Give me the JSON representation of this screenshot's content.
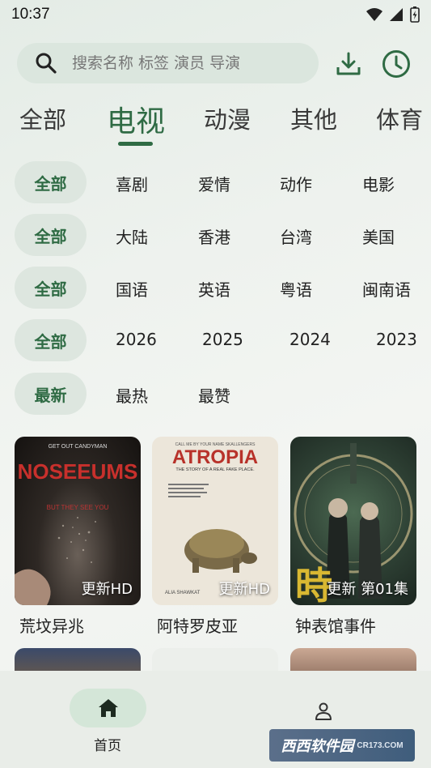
{
  "status": {
    "time": "10:37"
  },
  "search": {
    "placeholder": "搜索名称 标签 演员 导演"
  },
  "categories": [
    {
      "label": "全部"
    },
    {
      "label": "电视"
    },
    {
      "label": "动漫"
    },
    {
      "label": "其他"
    },
    {
      "label": "体育"
    }
  ],
  "filters": [
    {
      "chip": "全部",
      "options": [
        "喜剧",
        "爱情",
        "动作",
        "电影"
      ]
    },
    {
      "chip": "全部",
      "options": [
        "大陆",
        "香港",
        "台湾",
        "美国"
      ]
    },
    {
      "chip": "全部",
      "options": [
        "国语",
        "英语",
        "粤语",
        "闽南语"
      ]
    },
    {
      "chip": "全部",
      "options": [
        "2026",
        "2025",
        "2024",
        "2023"
      ]
    },
    {
      "chip": "最新",
      "options": [
        "最热",
        "最赞"
      ]
    }
  ],
  "shows": [
    {
      "title": "荒坟异兆",
      "badge": "更新HD",
      "poster_text": "NOSEEUMS",
      "poster_top": "GET OUT  CANDYMAN",
      "poster_sub": "BUT THEY SEE YOU"
    },
    {
      "title": "阿特罗皮亚",
      "badge": "更新HD",
      "poster_text": "ATROPIA",
      "poster_sub": "THE STORY OF A REAL FAKE PLACE.",
      "poster_top": "CALL ME BY YOUR NAME  SKALLENGERS",
      "poster_credit": "ALIA SHAWKAT"
    },
    {
      "title": "钟表馆事件",
      "badge": "更新 第01集",
      "poster_text": "時"
    }
  ],
  "nav": {
    "home": "首页"
  },
  "watermark": {
    "text": "西西软件园",
    "sub": "CR173.COM"
  }
}
